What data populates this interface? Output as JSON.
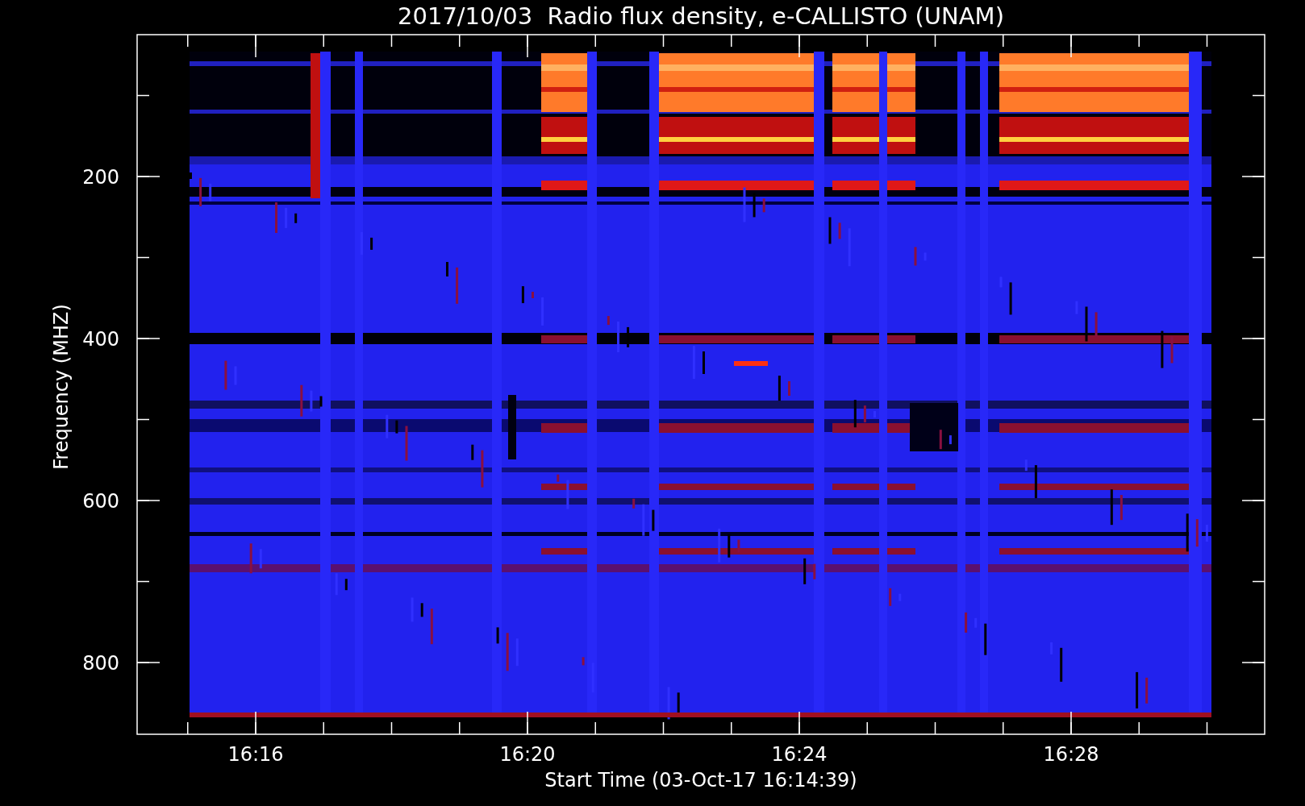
{
  "title": "2017/10/03  Radio flux density, e-CALLISTO (UNAM)",
  "y_axis": {
    "label": "Frequency (MHZ)",
    "ticks": [
      "200",
      "400",
      "600",
      "800"
    ]
  },
  "x_axis": {
    "label": "Start Time (03-Oct-17 16:14:39)",
    "ticks": [
      "16:16",
      "16:20",
      "16:24",
      "16:28"
    ]
  }
}
